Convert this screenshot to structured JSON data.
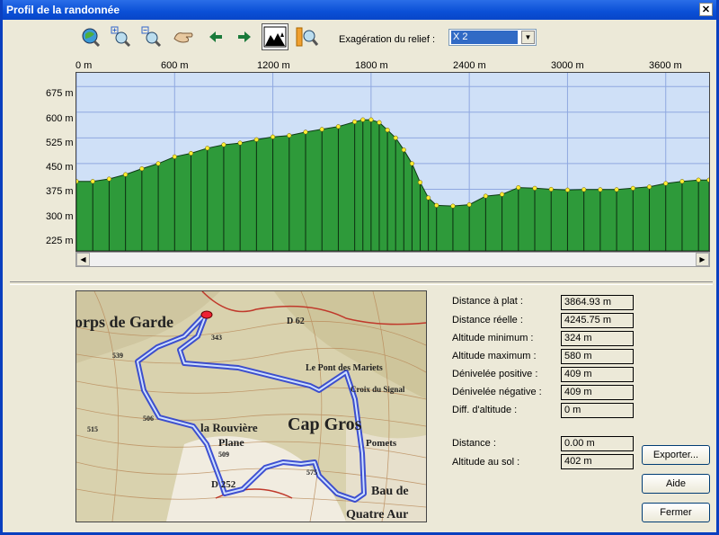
{
  "window": {
    "title": "Profil de la randonnée"
  },
  "toolbar": {
    "relief_label": "Exagération du relief :",
    "relief_value": "X 2",
    "buttons": [
      "zoom-full-icon",
      "zoom-in-icon",
      "zoom-out-icon",
      "pan-hand-icon",
      "arrow-left-icon",
      "arrow-right-icon",
      "profile-view-icon",
      "zoom-range-icon"
    ]
  },
  "profile": {
    "x_ticks": [
      "0 m",
      "600 m",
      "1200 m",
      "1800 m",
      "2400 m",
      "3000 m",
      "3600 m"
    ],
    "y_ticks": [
      "675 m",
      "600 m",
      "525 m",
      "450 m",
      "375 m",
      "300 m",
      "225 m"
    ],
    "colors": {
      "sky": "#cfe0f7",
      "terrain": "#2e9a3a",
      "waypoint": "#ffee33"
    }
  },
  "chart_data": {
    "type": "area",
    "x": [
      0,
      100,
      200,
      300,
      400,
      500,
      600,
      700,
      800,
      900,
      1000,
      1100,
      1200,
      1300,
      1400,
      1500,
      1600,
      1700,
      1750,
      1800,
      1850,
      1900,
      1950,
      2000,
      2050,
      2100,
      2150,
      2200,
      2300,
      2400,
      2500,
      2600,
      2700,
      2800,
      2900,
      3000,
      3100,
      3200,
      3300,
      3400,
      3500,
      3600,
      3700,
      3800,
      3865
    ],
    "values": [
      398,
      398,
      405,
      418,
      435,
      450,
      470,
      480,
      495,
      505,
      510,
      520,
      528,
      532,
      542,
      550,
      558,
      572,
      578,
      578,
      570,
      548,
      525,
      490,
      450,
      395,
      350,
      328,
      326,
      330,
      355,
      360,
      380,
      378,
      375,
      373,
      374,
      374,
      374,
      378,
      382,
      392,
      398,
      402,
      402
    ],
    "xlim": [
      0,
      3865
    ],
    "ylim": [
      195,
      715
    ],
    "xlabel": "",
    "ylabel": ""
  },
  "stats": [
    {
      "label": "Distance à plat :",
      "value": "3864.93 m"
    },
    {
      "label": "Distance réelle :",
      "value": "4245.75 m"
    },
    {
      "label": "Altitude minimum :",
      "value": "324 m"
    },
    {
      "label": "Altitude maximum :",
      "value": "580 m"
    },
    {
      "label": "Dénivelée positive :",
      "value": "409 m"
    },
    {
      "label": "Dénivelée négative :",
      "value": "409 m"
    },
    {
      "label": "Diff. d'altitude :",
      "value": "0 m"
    }
  ],
  "cursor": [
    {
      "label": "Distance :",
      "value": "0.00 m"
    },
    {
      "label": "Altitude au sol :",
      "value": "402 m"
    }
  ],
  "buttons": {
    "export": "Exporter...",
    "help": "Aide",
    "close": "Fermer"
  },
  "map": {
    "labels": [
      "orps de Garde",
      "D 62",
      "Le Pont des Mariets",
      "Croix du Signal",
      "Cap Gros",
      "la Rouvière",
      "Plane",
      "Pomets",
      "Bau de",
      "Quatre Aur",
      "343",
      "539",
      "506",
      "509",
      "515",
      "575",
      "D 252"
    ]
  }
}
